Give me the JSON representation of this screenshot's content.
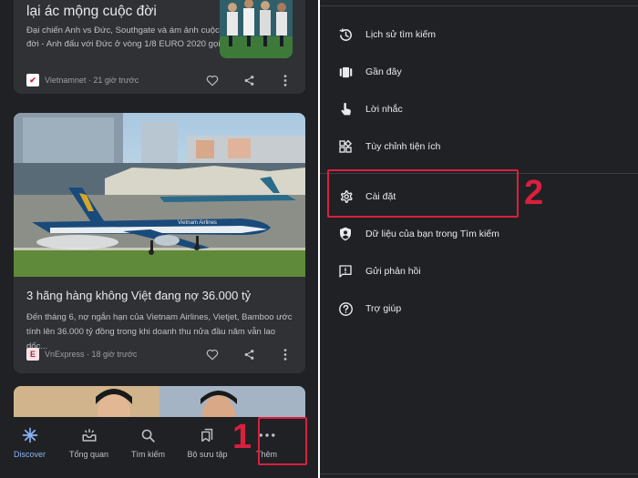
{
  "left_panel": {
    "card1": {
      "title": "lại ác mộng cuộc đời",
      "snippet": "Đại chiến Anh vs Đức, Southgate và ám ảnh cuộc đời - Anh đấu với Đức ở vòng 1/8 EURO 2020 gọi",
      "source_logo": "✔",
      "source": "Vietnamnet · 21 giờ trước"
    },
    "card2": {
      "title": "3 hãng hàng không Việt đang nợ 36.000 tỷ",
      "snippet": "Đến tháng 6, nợ ngắn hạn của Vietnam Airlines, Vietjet, Bamboo ước tính lên 36.000 tỷ đồng trong khi doanh thu nửa đầu năm vẫn lao dốc...",
      "source_logo": "E",
      "source": "VnExpress · 18 giờ trước",
      "image_text": "Vietnam Airlines"
    },
    "bottom_nav": [
      {
        "label": "Discover",
        "icon": "asterisk-icon",
        "active": true
      },
      {
        "label": "Tổng quan",
        "icon": "inbox-icon",
        "active": false
      },
      {
        "label": "Tìm kiếm",
        "icon": "search-icon",
        "active": false
      },
      {
        "label": "Bộ sưu tập",
        "icon": "bookmarks-icon",
        "active": false
      },
      {
        "label": "Thêm",
        "icon": "more-dots-icon",
        "active": false
      }
    ],
    "step_number": "1"
  },
  "right_panel": {
    "menu": [
      {
        "label": "Lịch sử tìm kiếm",
        "icon": "history-icon"
      },
      {
        "label": "Gần đây",
        "icon": "recent-cards-icon"
      },
      {
        "label": "Lời nhắc",
        "icon": "reminder-hand-icon"
      },
      {
        "label": "Tùy chỉnh tiện ích",
        "icon": "customize-widget-icon"
      },
      {
        "label": "Cài đặt",
        "icon": "gear-icon"
      },
      {
        "label": "Dữ liệu của bạn trong Tìm kiếm",
        "icon": "shield-person-icon"
      },
      {
        "label": "Gửi phản hồi",
        "icon": "feedback-icon"
      },
      {
        "label": "Trợ giúp",
        "icon": "help-icon"
      }
    ],
    "step_number": "2"
  },
  "colors": {
    "background": "#202124",
    "card": "#303134",
    "accent_active": "#8ab4f8",
    "highlight": "#d9203f"
  }
}
